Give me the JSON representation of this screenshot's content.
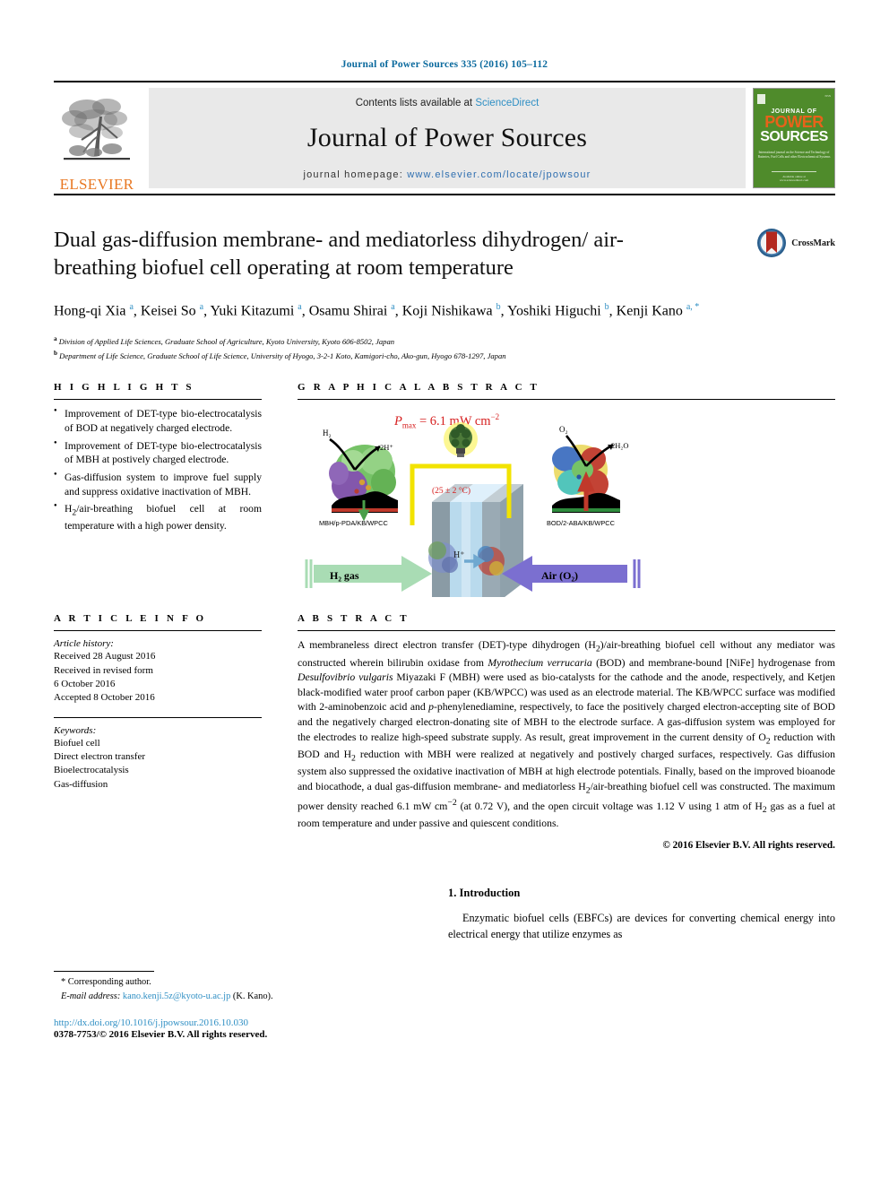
{
  "running_head": "Journal of Power Sources 335 (2016) 105–112",
  "masthead": {
    "contents_prefix": "Contents lists available at ",
    "sciencedirect": "ScienceDirect",
    "journal_title": "Journal of Power Sources",
    "homepage_prefix": "journal homepage: ",
    "homepage_url": "www.elsevier.com/locate/jpowsour",
    "publisher": "ELSEVIER",
    "cover": {
      "line1": "JOURNAL OF",
      "line2": "POWER",
      "line3": "SOURCES",
      "blurb": "International journal on the Science and Technology of Batteries, Fuel Cells and other Electrochemical Systems",
      "footer": "Available online at www.sciencedirect.com"
    }
  },
  "article": {
    "title": "Dual gas-diffusion membrane- and mediatorless dihydrogen/ air-breathing biofuel cell operating at room temperature",
    "crossmark_label": "CrossMark",
    "authors_html": "Hong-qi Xia <sup>a</sup>, Keisei So <sup>a</sup>, Yuki Kitazumi <sup>a</sup>, Osamu Shirai <sup>a</sup>, Koji Nishikawa <sup>b</sup>, Yoshiki Higuchi <sup>b</sup>, Kenji Kano <sup>a, *</sup>",
    "affiliation_a": "Division of Applied Life Sciences, Graduate School of Agriculture, Kyoto University, Kyoto 606-8502, Japan",
    "affiliation_b": "Department of Life Science, Graduate School of Life Science, University of Hyogo, 3-2-1 Koto, Kamigori-cho, Ako-gun, Hyogo 678-1297, Japan"
  },
  "sections": {
    "highlights": "H I G H L I G H T S",
    "graphical_abstract": "G R A P H I C A L   A B S T R A C T",
    "article_info": "A R T I C L E   I N F O",
    "abstract": "A B S T R A C T"
  },
  "highlights": [
    "Improvement of DET-type bio-electrocatalysis of BOD at negatively charged electrode.",
    "Improvement of DET-type bio-electrocatalysis of MBH at postively charged electrode.",
    "Gas-diffusion system to improve fuel supply and suppress oxidative inactivation of MBH.",
    "H2/air-breathing biofuel cell at room temperature with a high power density."
  ],
  "article_info": {
    "history_label": "Article history:",
    "history": [
      "Received 28 August 2016",
      "Received in revised form",
      "6 October 2016",
      "Accepted 8 October 2016"
    ],
    "keywords_label": "Keywords:",
    "keywords": [
      "Biofuel cell",
      "Direct electron transfer",
      "Bioelectrocatalysis",
      "Gas-diffusion"
    ]
  },
  "abstract_html": "A membraneless direct electron transfer (DET)-type dihydrogen (H<sub>2</sub>)/air-breathing biofuel cell without any mediator was constructed wherein bilirubin oxidase from <i>Myrothecium verrucaria</i> (BOD) and membrane-bound [NiFe] hydrogenase from <i>Desulfovibrio vulgaris</i> Miyazaki F (MBH) were used as bio-catalysts for the cathode and the anode, respectively, and Ketjen black-modified water proof carbon paper (KB/WPCC) was used as an electrode material. The KB/WPCC surface was modified with 2-aminobenzoic acid and <i>p</i>-phenylenediamine, respectively, to face the positively charged electron-accepting site of BOD and the negatively charged electron-donating site of MBH to the electrode surface. A gas-diffusion system was employed for the electrodes to realize high-speed substrate supply. As result, great improvement in the current density of O<sub>2</sub> reduction with BOD and H<sub>2</sub> reduction with MBH were realized at negatively and postively charged surfaces, respectively. Gas diffusion system also suppressed the oxidative inactivation of MBH at high electrode potentials. Finally, based on the improved bioanode and biocathode, a dual gas-diffusion membrane- and mediatorless H<sub>2</sub>/air-breathing biofuel cell was constructed. The maximum power density reached 6.1 mW cm<sup>&minus;2</sup> (at 0.72 V), and the open circuit voltage was 1.12 V using 1 atm of H<sub>2</sub> gas as a fuel at room temperature and under passive and quiescent conditions.",
  "copyright": "© 2016 Elsevier B.V. All rights reserved.",
  "graphical_abstract": {
    "pmax_label": "P",
    "pmax_sub": "max",
    "pmax_value": " = 6.1 mW cm",
    "pmax_exp": "−2",
    "temperature": "(25 ± 2 °C)",
    "anode_electrode": "MBH/p-PDA/KB/WPCC",
    "cathode_electrode": "BOD/2-ABA/KB/WPCC",
    "fuel_inlet": "H2 gas",
    "air_inlet": "Air (O2)",
    "proton_label": "H+",
    "h2_label": "H2",
    "proton_product": "2H+",
    "o2_label": "O2",
    "water_label": "2H2O",
    "colors": {
      "fuel_arrow": "#a9dcb4",
      "air_arrow": "#7b6fd0",
      "cell_body": "#a8bfcc",
      "cell_membrane": "#bfe2f5",
      "wire": "#f2e300",
      "pmax_text": "#d61f1f"
    }
  },
  "footer": {
    "corresponding": "* Corresponding author.",
    "email_label": "E-mail address:",
    "email": "kano.kenji.5z@kyoto-u.ac.jp",
    "email_suffix": "(K. Kano).",
    "doi": "http://dx.doi.org/10.1016/j.jpowsour.2016.10.030",
    "issn": "0378-7753/© 2016 Elsevier B.V. All rights reserved."
  },
  "introduction": {
    "heading": "1. Introduction",
    "paragraph": "Enzymatic biofuel cells (EBFCs) are devices for converting chemical energy into electrical energy that utilize enzymes as"
  }
}
